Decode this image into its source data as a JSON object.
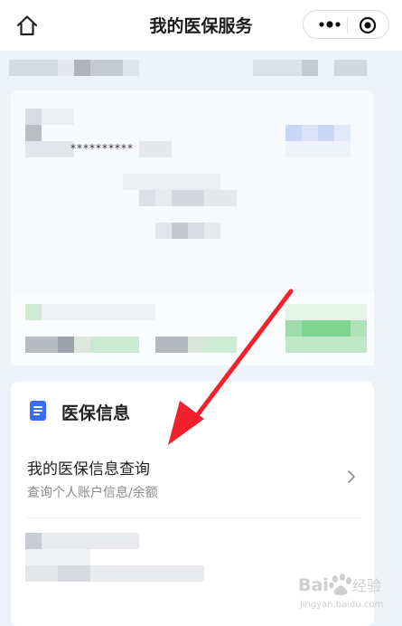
{
  "nav": {
    "title": "我的医保服务",
    "home_icon": "home-icon",
    "more_icon": "more-dots-icon",
    "close_icon": "target-close-icon"
  },
  "masked": {
    "card_number": "**********"
  },
  "section": {
    "title": "医保信息",
    "icon": "document-icon",
    "accent": "#3a6ff5"
  },
  "menu": {
    "item_title": "我的医保信息查询",
    "item_subtitle": "查询个人账户信息/余额",
    "chevron_icon": "chevron-right-icon"
  },
  "annotation": {
    "arrow_color": "#f2212b"
  },
  "watermark": {
    "brand": "Baidu",
    "brand_cn": "经验",
    "url": "jingyan.baidu.com"
  }
}
